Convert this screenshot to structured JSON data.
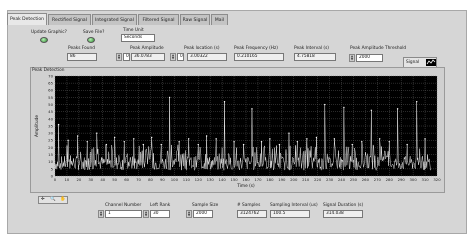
{
  "tabs": [
    "Peak Detection",
    "Rectified Signal",
    "Integrated Signal",
    "Filtered Signal",
    "Raw Signal",
    "Mail"
  ],
  "controls": {
    "update_graphic_label": "Update Graphic?",
    "save_file_label": "Save File?",
    "time_unit_label": "Time Unit",
    "time_unit_value": "Seconds"
  },
  "indicators": {
    "peaks_found_label": "Peaks Found",
    "peaks_found_value": "86",
    "peak_amplitude_label": "Peak Amplitude",
    "peak_amplitude_index": "0",
    "peak_amplitude_value": "36.0783",
    "peak_location_label": "Peak location (s)",
    "peak_location_index": "0",
    "peak_location_value": "3.00322",
    "peak_frequency_label": "Peak Frequency (Hz)",
    "peak_frequency_value": "0.210165",
    "peak_interval_label": "Peak Interval (s)",
    "peak_interval_value": "4.75818",
    "threshold_label": "Peak Amplitude Threshold",
    "threshold_value": "2000"
  },
  "graph": {
    "title": "Peak Detection",
    "xlabel": "Time (s)",
    "ylabel": "Amplitude",
    "legend": [
      "Signal",
      "Peaks"
    ],
    "xlim": [
      0,
      320
    ],
    "ylim": [
      0,
      70
    ],
    "xticks": [
      "0",
      "10",
      "20",
      "30",
      "40",
      "50",
      "60",
      "70",
      "80",
      "90",
      "100",
      "110",
      "120",
      "130",
      "140",
      "150",
      "160",
      "170",
      "180",
      "190",
      "200",
      "210",
      "220",
      "230",
      "240",
      "250",
      "260",
      "270",
      "280",
      "290",
      "300",
      "310",
      "320"
    ],
    "yticks": [
      "0",
      "5",
      "10",
      "15",
      "20",
      "25",
      "30",
      "35",
      "40",
      "45",
      "50",
      "55",
      "60",
      "65",
      "70"
    ]
  },
  "bottom": {
    "channel_number_label": "Channel Number",
    "channel_number_value": "1",
    "left_rank_label": "Left Rank",
    "left_rank_value": "30",
    "sample_size_label": "Sample Size",
    "sample_size_value": "2000",
    "num_samples_label": "# Samples",
    "num_samples_value": "3124762",
    "sampling_interval_label": "Sampling Interval (us)",
    "sampling_interval_value": "100.5",
    "signal_duration_label": "Signal Duration (s)",
    "signal_duration_value": "314.038"
  },
  "chart_data": {
    "type": "line",
    "title": "Peak Detection",
    "xlabel": "Time (s)",
    "ylabel": "Amplitude",
    "xlim": [
      0,
      320
    ],
    "ylim": [
      0,
      70
    ],
    "series": [
      {
        "name": "Signal",
        "baseline": [
          4,
          14
        ],
        "spikes": [
          [
            3,
            36
          ],
          [
            11,
            25
          ],
          [
            19,
            28
          ],
          [
            27,
            24
          ],
          [
            35,
            30
          ],
          [
            43,
            22
          ],
          [
            50,
            27
          ],
          [
            58,
            24
          ],
          [
            66,
            26
          ],
          [
            74,
            22
          ],
          [
            81,
            27
          ],
          [
            89,
            22
          ],
          [
            96,
            55
          ],
          [
            104,
            24
          ],
          [
            112,
            26
          ],
          [
            120,
            22
          ],
          [
            127,
            28
          ],
          [
            135,
            26
          ],
          [
            142,
            52
          ],
          [
            150,
            24
          ],
          [
            158,
            22
          ],
          [
            165,
            47
          ],
          [
            173,
            24
          ],
          [
            180,
            26
          ],
          [
            188,
            22
          ],
          [
            196,
            30
          ],
          [
            203,
            24
          ],
          [
            211,
            26
          ],
          [
            219,
            27
          ],
          [
            226,
            50
          ],
          [
            234,
            26
          ],
          [
            242,
            48
          ],
          [
            249,
            22
          ],
          [
            257,
            24
          ],
          [
            265,
            46
          ],
          [
            272,
            26
          ],
          [
            280,
            24
          ],
          [
            287,
            47
          ],
          [
            295,
            22
          ],
          [
            303,
            52
          ],
          [
            310,
            26
          ]
        ]
      },
      {
        "name": "Peaks"
      }
    ]
  }
}
